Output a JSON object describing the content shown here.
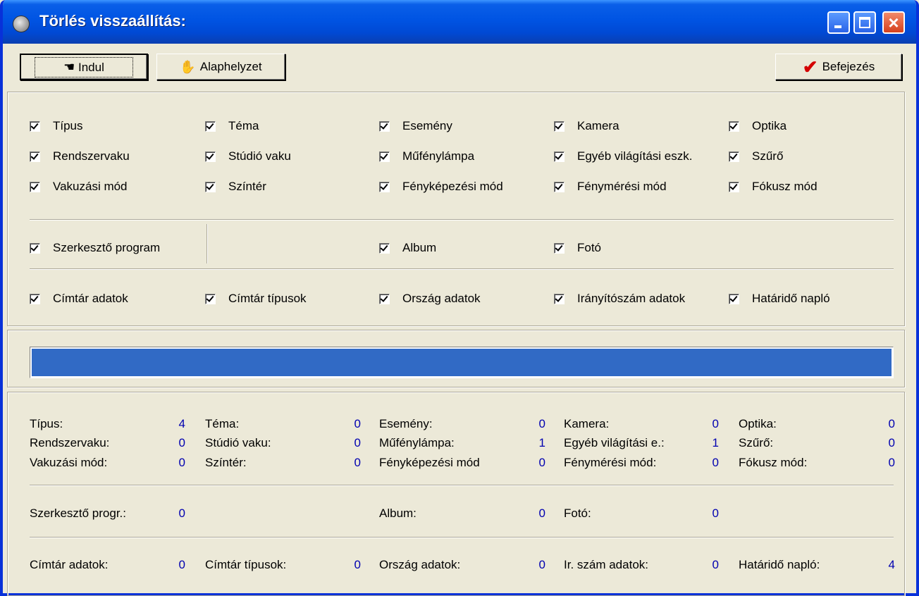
{
  "window": {
    "title": "Törlés visszaállítás:"
  },
  "toolbar": {
    "start": "Indul",
    "reset": "Alaphelyzet",
    "finish": "Befejezés"
  },
  "checkboxes": {
    "row1": [
      "Típus",
      "Téma",
      "Esemény",
      "Kamera",
      "Optika"
    ],
    "row2": [
      "Rendszervaku",
      "Stúdió vaku",
      "Műfénylámpa",
      "Egyéb világítási eszk.",
      "Szűrő"
    ],
    "row3": [
      "Vakuzási mód",
      "Színtér",
      "Fényképezési mód",
      "Fénymérési mód",
      "Fókusz mód"
    ],
    "row4": [
      "Szerkesztő program",
      "Album",
      "Fotó"
    ],
    "row5": [
      "Címtár adatok",
      "Címtár típusok",
      "Ország adatok",
      "Irányítószám adatok",
      "Határidő napló"
    ]
  },
  "progress": {
    "value": 1.0,
    "color": "#316ac5"
  },
  "stats": {
    "row1": [
      {
        "label": "Típus:",
        "value": "4"
      },
      {
        "label": "Téma:",
        "value": "0"
      },
      {
        "label": "Esemény:",
        "value": "0"
      },
      {
        "label": "Kamera:",
        "value": "0"
      },
      {
        "label": "Optika:",
        "value": "0"
      }
    ],
    "row2": [
      {
        "label": "Rendszervaku:",
        "value": "0"
      },
      {
        "label": "Stúdió vaku:",
        "value": "0"
      },
      {
        "label": "Műfénylámpa:",
        "value": "1"
      },
      {
        "label": "Egyéb világítási e.:",
        "value": "1"
      },
      {
        "label": "Szűrő:",
        "value": "0"
      }
    ],
    "row3": [
      {
        "label": "Vakuzási mód:",
        "value": "0"
      },
      {
        "label": "Színtér:",
        "value": "0"
      },
      {
        "label": "Fényképezési mód",
        "value": "0"
      },
      {
        "label": "Fénymérési mód:",
        "value": "0"
      },
      {
        "label": "Fókusz mód:",
        "value": "0"
      }
    ],
    "row4": [
      {
        "label": "Szerkesztő progr.:",
        "value": "0"
      },
      {
        "label": "Album:",
        "value": "0"
      },
      {
        "label": "Fotó:",
        "value": "0"
      }
    ],
    "row5": [
      {
        "label": "Címtár adatok:",
        "value": "0"
      },
      {
        "label": "Címtár típusok:",
        "value": "0"
      },
      {
        "label": "Ország adatok:",
        "value": "0"
      },
      {
        "label": "Ir. szám adatok:",
        "value": "0"
      },
      {
        "label": "Határidő napló:",
        "value": "4"
      }
    ]
  }
}
